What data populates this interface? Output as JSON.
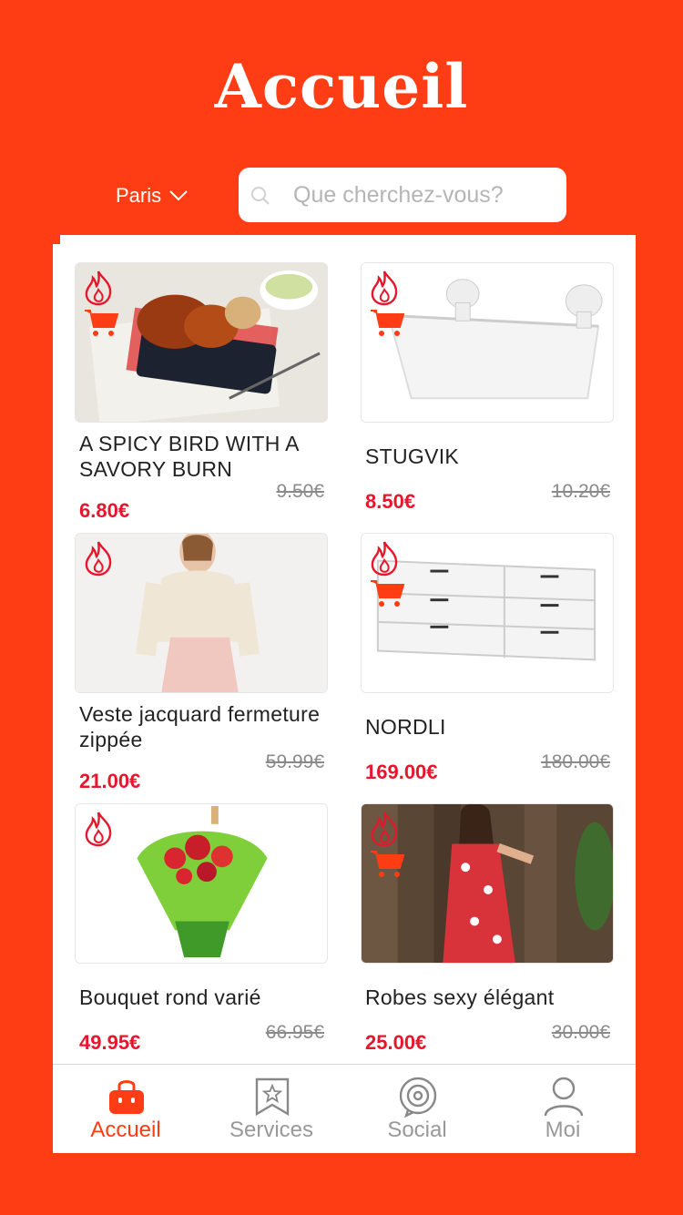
{
  "header": {
    "title": "Accueil"
  },
  "location": {
    "city": "Paris"
  },
  "search": {
    "placeholder": "Que cherchez-vous?"
  },
  "products": [
    {
      "name": "A SPICY BIRD WITH A SAVORY BURN",
      "price": "6.80€",
      "old_price": "9.50€"
    },
    {
      "name": "STUGVIK",
      "price": "8.50€",
      "old_price": "10.20€"
    },
    {
      "name": "Veste jacquard fermeture zippée",
      "price": "21.00€",
      "old_price": "59.99€"
    },
    {
      "name": "NORDLI",
      "price": "169.00€",
      "old_price": "180.00€"
    },
    {
      "name": "Bouquet rond varié",
      "price": "49.95€",
      "old_price": "66.95€"
    },
    {
      "name": "Robes sexy élégant",
      "price": "25.00€",
      "old_price": "30.00€"
    }
  ],
  "tabs": [
    {
      "label": "Accueil",
      "active": true,
      "icon": "shopping-bag-icon"
    },
    {
      "label": "Services",
      "active": false,
      "icon": "bookmark-star-icon"
    },
    {
      "label": "Social",
      "active": false,
      "icon": "target-icon"
    },
    {
      "label": "Moi",
      "active": false,
      "icon": "person-icon"
    }
  ],
  "colors": {
    "accent": "#FF3D14",
    "price": "#E8162C",
    "muted": "#999999"
  }
}
